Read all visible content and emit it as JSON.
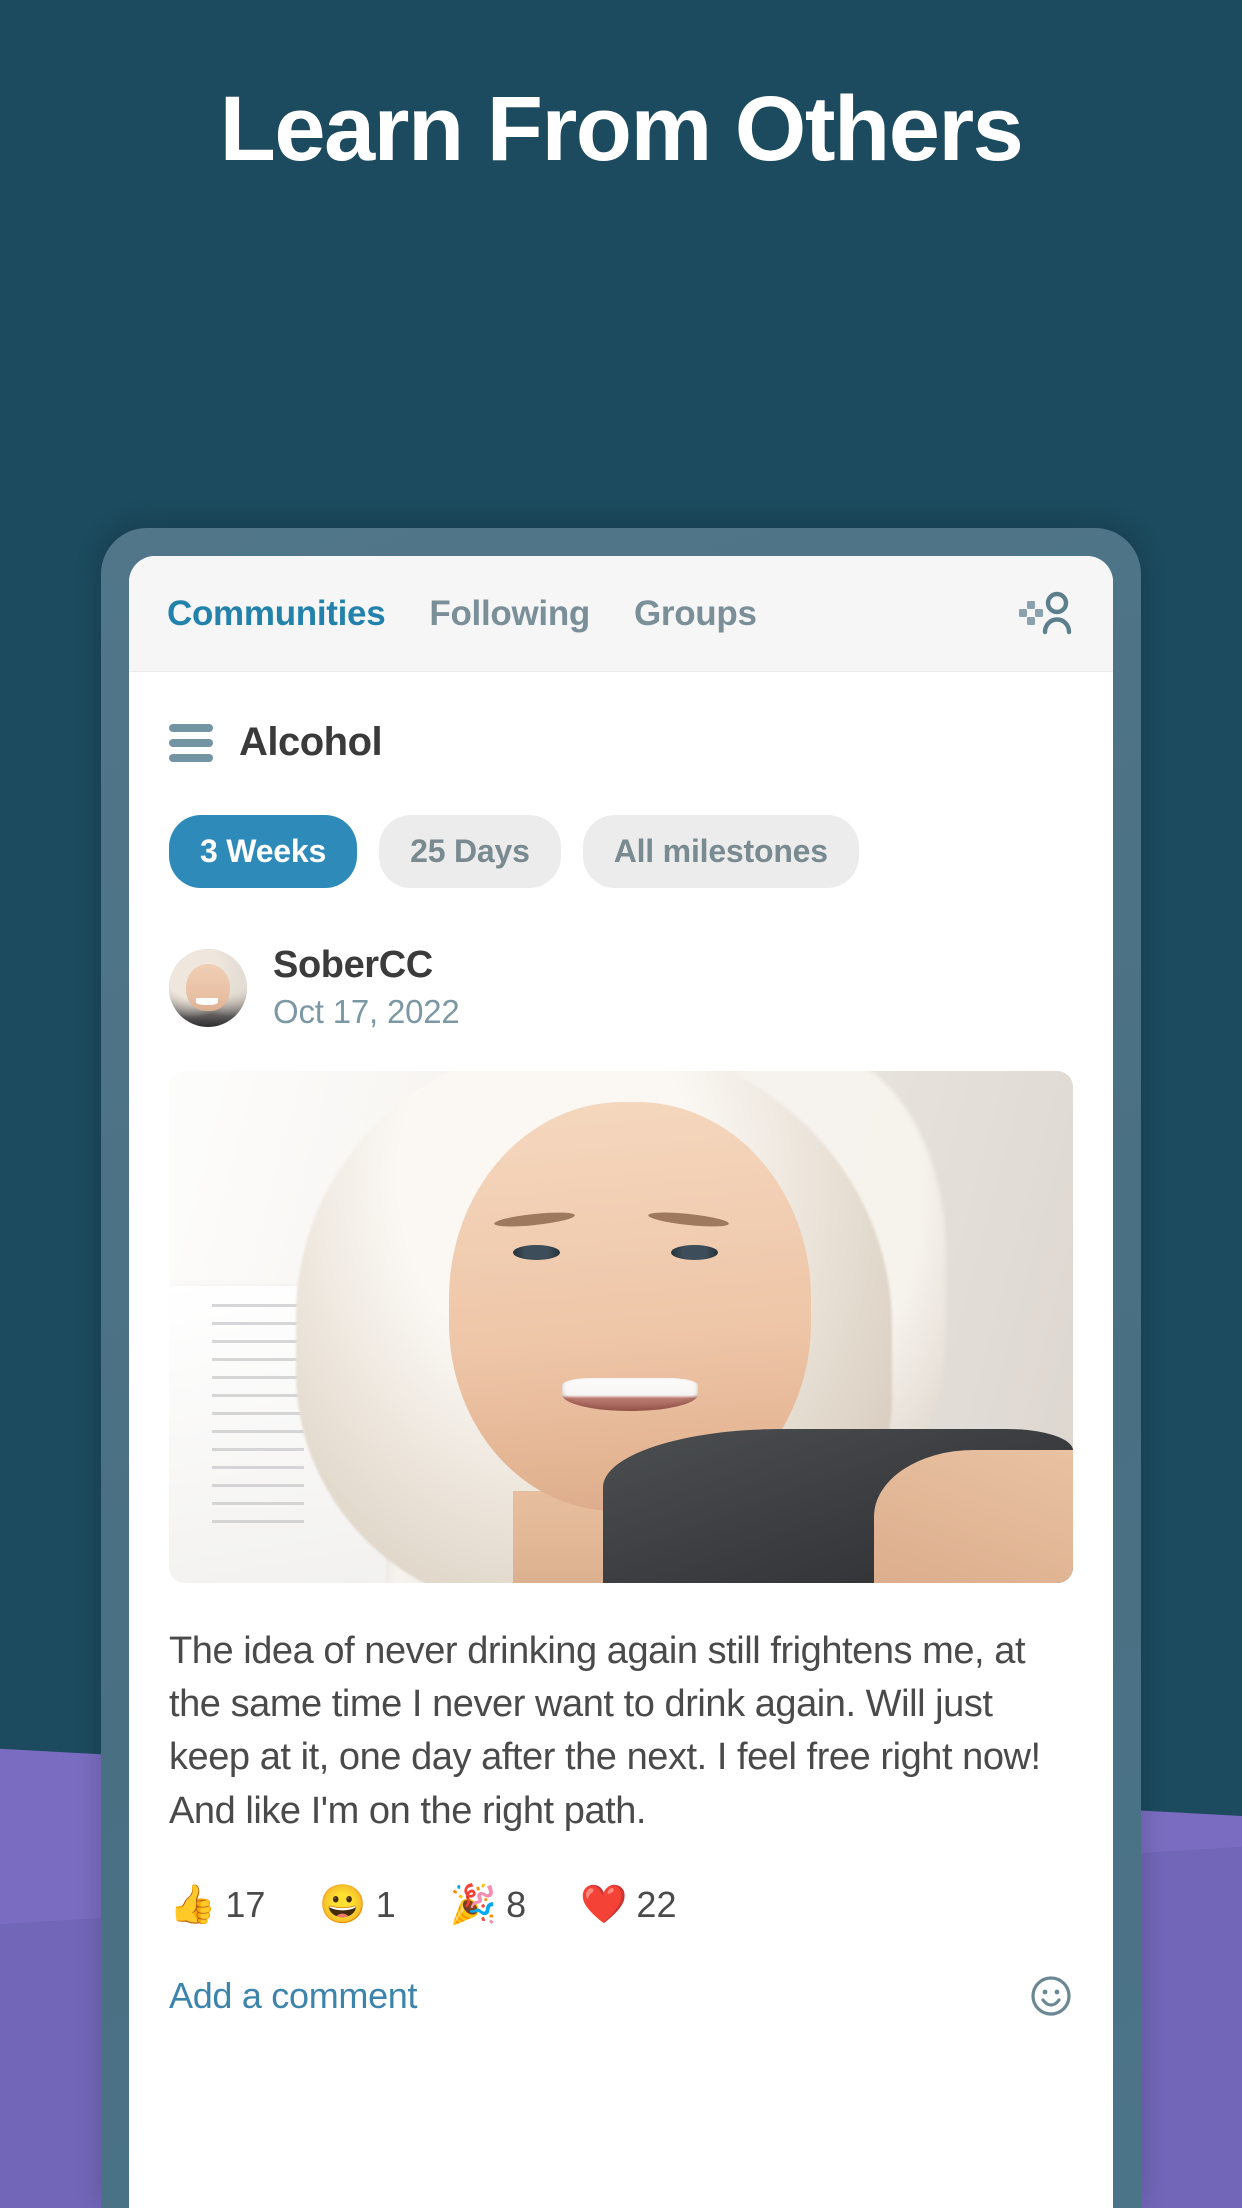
{
  "promo": {
    "headline": "Learn From Others",
    "background_color": "#1c4a5e",
    "accent_purple": "#7a6cc0"
  },
  "app": {
    "tabs": [
      {
        "label": "Communities",
        "active": true
      },
      {
        "label": "Following",
        "active": false
      },
      {
        "label": "Groups",
        "active": false
      }
    ],
    "profile_icon": "person-sparkle-icon",
    "community": {
      "menu_icon": "hamburger-menu-icon",
      "title": "Alcohol"
    },
    "filters": [
      {
        "label": "3 Weeks",
        "active": true
      },
      {
        "label": "25 Days",
        "active": false
      },
      {
        "label": "All milestones",
        "active": false
      }
    ],
    "post": {
      "avatar": "user-avatar",
      "username": "SoberCC",
      "date": "Oct 17, 2022",
      "photo": "user-selfie-photo",
      "body": "The idea of never drinking again still frightens me, at the same time I never want to drink again. Will just keep at it, one day after the next. I feel free right now! And like I'm on the right path.",
      "reactions": [
        {
          "emoji": "👍",
          "name": "thumbs-up-reaction",
          "count": "17"
        },
        {
          "emoji": "😀",
          "name": "grinning-face-reaction",
          "count": "1"
        },
        {
          "emoji": "🎉",
          "name": "party-popper-reaction",
          "count": "8"
        },
        {
          "emoji": "❤️",
          "name": "red-heart-reaction",
          "count": "22"
        }
      ],
      "comment_prompt": "Add a comment",
      "emoji_picker_icon": "smiley-face-icon"
    },
    "colors": {
      "tab_active": "#2382ab",
      "tab_inactive": "#7b8f99",
      "chip_active_bg": "#2e8ab8",
      "chip_inactive_bg": "#ececec",
      "link": "#3d84ad"
    }
  }
}
